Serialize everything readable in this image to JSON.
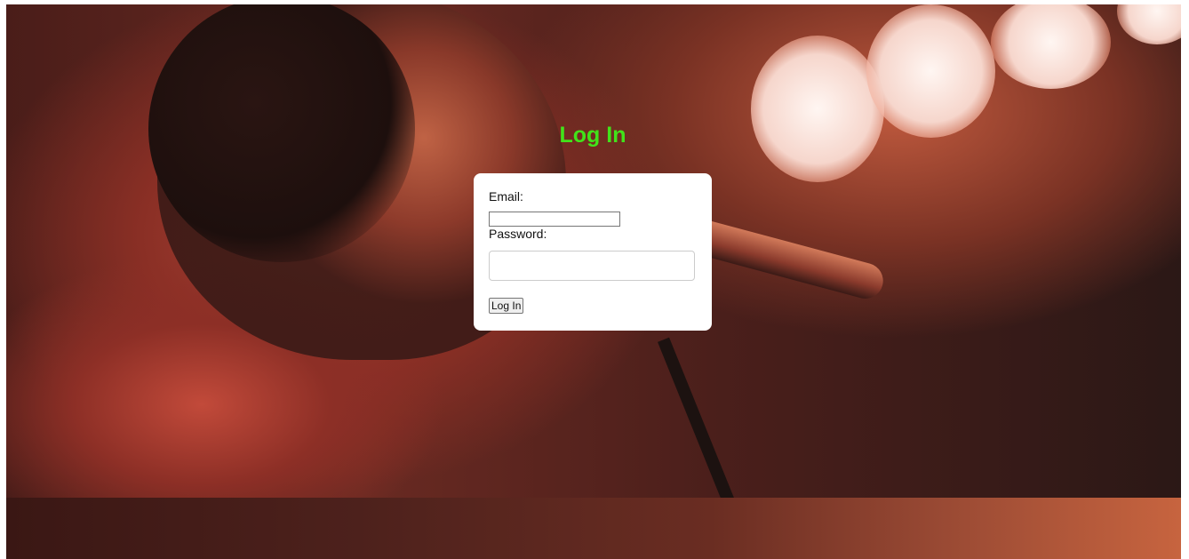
{
  "page": {
    "title": "Log In"
  },
  "form": {
    "email_label": "Email:",
    "email_value": "",
    "password_label": "Password:",
    "password_value": "",
    "submit_label": "Log In"
  },
  "colors": {
    "title": "#41e31a",
    "card_background": "#ffffff"
  }
}
